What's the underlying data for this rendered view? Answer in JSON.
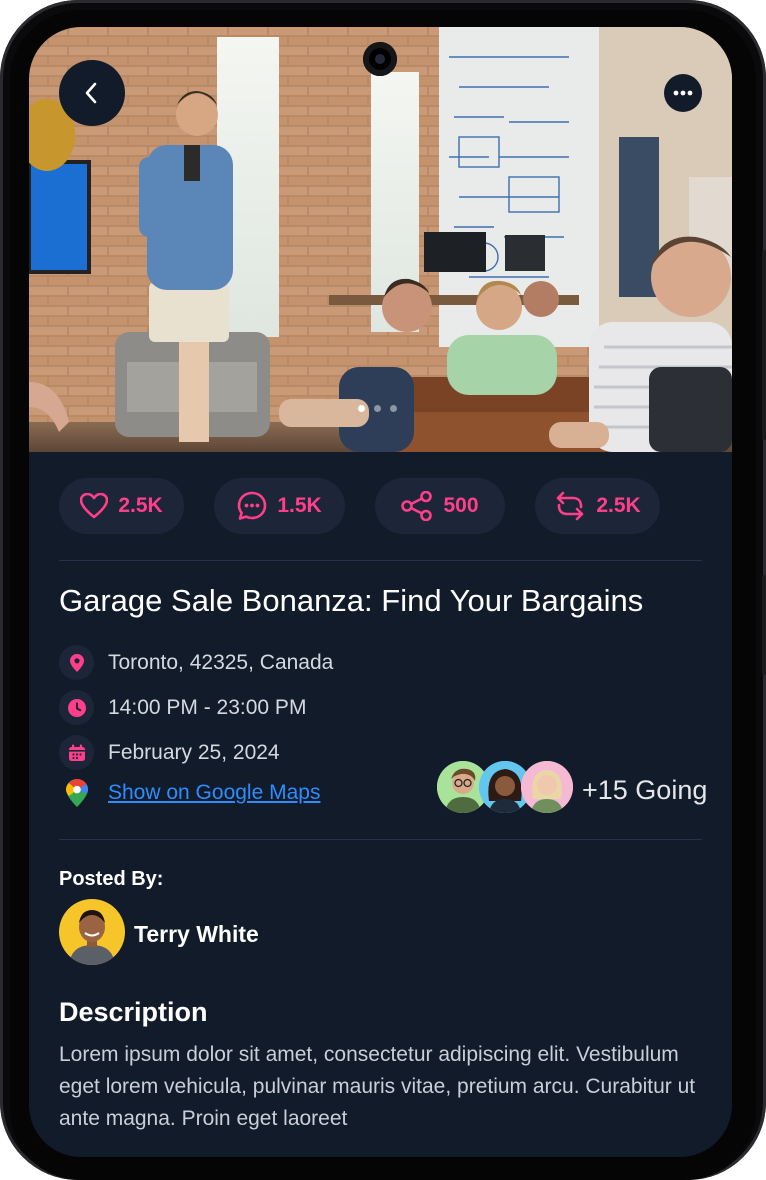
{
  "hero": {
    "page_count": 3,
    "active_page": 1
  },
  "stats": {
    "likes": "2.5K",
    "comments": "1.5K",
    "shares": "500",
    "reposts": "2.5K"
  },
  "event": {
    "title": "Garage Sale Bonanza: Find Your Bargains",
    "location": "Toronto, 42325, Canada",
    "time": "14:00 PM - 23:00 PM",
    "date": "February 25, 2024",
    "maps_link": "Show on Google Maps",
    "going": "+15 Going"
  },
  "posted_by": {
    "label": "Posted By:",
    "name": "Terry White"
  },
  "description": {
    "title": "Description",
    "body": "Lorem ipsum dolor sit amet, consectetur adipiscing elit. Vestibulum eget lorem vehicula, pulvinar mauris vitae, pretium arcu. Curabitur ut ante magna. Proin eget laoreet"
  },
  "colors": {
    "accent": "#ff3f8a",
    "background": "#111b29",
    "chip": "#1c2638",
    "link": "#2d8cff"
  },
  "icons": [
    "back-arrow-icon",
    "more-icon",
    "heart-icon",
    "comment-icon",
    "share-icon",
    "repost-icon",
    "location-pin-icon",
    "clock-icon",
    "calendar-icon",
    "google-maps-icon"
  ]
}
